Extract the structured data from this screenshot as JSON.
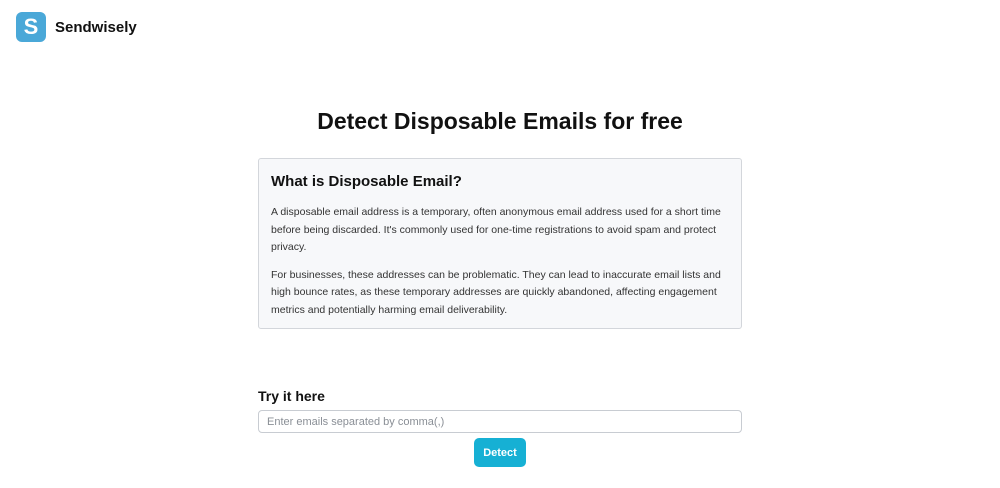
{
  "brand": {
    "logo_letter": "S",
    "name": "Sendwisely",
    "logo_color": "#4aa8d8"
  },
  "main": {
    "title": "Detect Disposable Emails for free",
    "info": {
      "heading": "What is Disposable Email?",
      "paragraphs": [
        "A disposable email address is a temporary, often anonymous email address used for a short time before being discarded. It's commonly used for one-time registrations to avoid spam and protect privacy.",
        "For businesses, these addresses can be problematic. They can lead to inaccurate email lists and high bounce rates, as these temporary addresses are quickly abandoned, affecting engagement metrics and potentially harming email deliverability."
      ]
    },
    "try": {
      "label": "Try it here",
      "input_value": "",
      "input_placeholder": "Enter emails separated by comma(,)",
      "button_label": "Detect",
      "button_color": "#16b0d4"
    }
  }
}
